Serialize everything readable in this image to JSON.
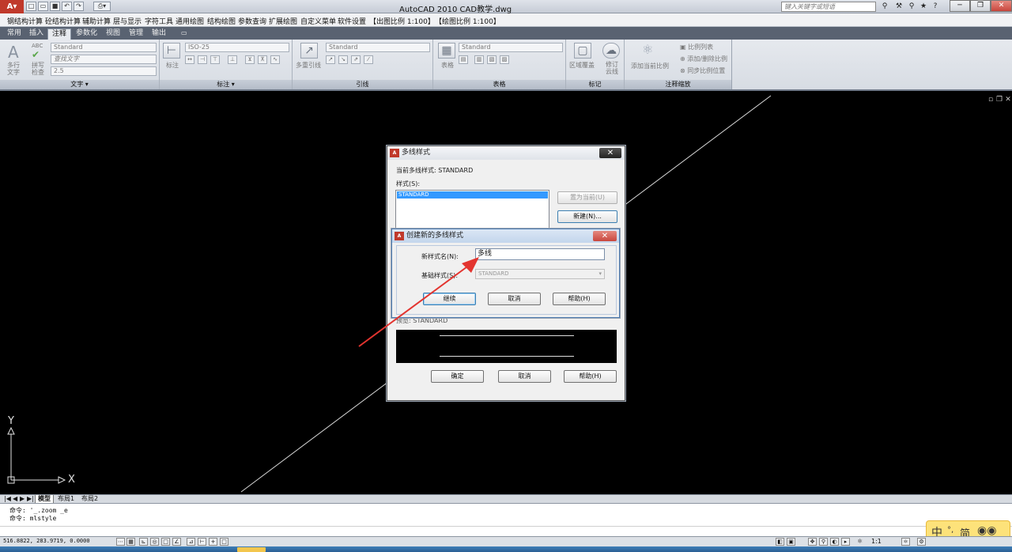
{
  "window": {
    "title": "AutoCAD 2010     CAD教学.dwg",
    "search_placeholder": "键入关键字或短语",
    "buttons": [
      "─",
      "❐",
      "✕"
    ]
  },
  "menubar": {
    "items": [
      "钢结构计算",
      "砼结构计算",
      "辅助计算",
      "层与显示",
      "字符工具",
      "通用绘图",
      "结构绘图",
      "参数查询",
      "扩展绘图",
      "自定义菜单",
      "软件设置",
      "【出图比例 1:100】",
      "【绘图比例 1:100】"
    ]
  },
  "tabs": {
    "items": [
      "常用",
      "插入",
      "注释",
      "参数化",
      "视图",
      "管理",
      "输出"
    ],
    "active_index": 2
  },
  "ribbon": {
    "text_panel": {
      "title": "文字",
      "multiline_text": "多行\n文字",
      "spell_check": "拼写\n检查",
      "style_combo": "Standard",
      "find_text": "查找文字",
      "height_combo": "2.5"
    },
    "dim_panel": {
      "title": "标注",
      "dim_label": "标注",
      "style_combo": "ISO-25"
    },
    "leader_panel": {
      "title": "引线",
      "multileader": "多重引线",
      "style_combo": "Standard"
    },
    "table_panel": {
      "title": "表格",
      "table_label": "表格",
      "style_combo": "Standard"
    },
    "markup_panel": {
      "title": "标记",
      "create_revcloud": "区域覆盖",
      "revcloud": "修订\n云线"
    },
    "scale_panel": {
      "title": "注释缩放",
      "add_current_scale": "添加当前比例",
      "scale_list": "比例列表",
      "add_delete_scales": "添加/删除比例",
      "sync_scale_positions": "同步比例位置"
    }
  },
  "viewport_controls": [
    "▫",
    "❐",
    "✕"
  ],
  "ucs": {
    "x_label": "X",
    "y_label": "Y"
  },
  "layout_tabs": {
    "nav": [
      "|◀",
      "◀",
      "▶",
      "▶|"
    ],
    "items": [
      "模型",
      "布局1",
      "布局2"
    ],
    "active_index": 0
  },
  "command_lines": [
    "命令: '_.zoom _e",
    "命令: mlstyle"
  ],
  "statusbar": {
    "coords": "516.8822, 283.9719, 0.0000",
    "scale": "1:1"
  },
  "ime": {
    "lang": "中",
    "mode": "°,",
    "simplified": "简"
  },
  "mlstyle_dialog": {
    "title": "多线样式",
    "current_style": "当前多线样式: STANDARD",
    "styles_label": "样式(S):",
    "styles": [
      "STANDARD"
    ],
    "set_current": "置为当前(U)",
    "new_button": "新建(N)...",
    "preview_label": "预览: STANDARD",
    "ok": "确定",
    "cancel": "取消",
    "help": "帮助(H)"
  },
  "new_dialog": {
    "title": "创建新的多线样式",
    "name_label": "新样式名(N):",
    "name_value": "多线",
    "base_label": "基础样式(S):",
    "base_value": "STANDARD",
    "continue": "继续",
    "cancel": "取消",
    "help": "帮助(H)"
  },
  "colors": {
    "canvas": "#000000",
    "annotation_arrow": "#e3342f",
    "close_button": "#c9463d",
    "selected_item": "#3399ff"
  }
}
